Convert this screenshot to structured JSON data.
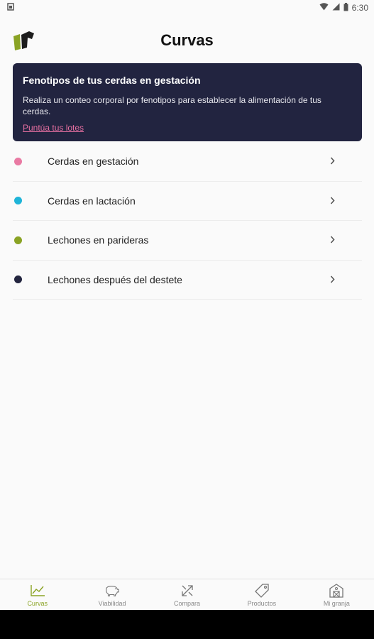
{
  "status_bar": {
    "time": "6:30"
  },
  "header": {
    "title": "Curvas"
  },
  "banner": {
    "title": "Fenotipos de tus cerdas en gestación",
    "text": "Realiza un conteo corporal por fenotipos para establecer la alimentación de tus cerdas.",
    "link": "Puntúa tus lotes"
  },
  "list": {
    "items": [
      {
        "label": "Cerdas en gestación",
        "color": "#e97aa3"
      },
      {
        "label": "Cerdas en lactación",
        "color": "#1fb4d8"
      },
      {
        "label": "Lechones en parideras",
        "color": "#8aa324"
      },
      {
        "label": "Lechones después del destete",
        "color": "#23253f"
      }
    ]
  },
  "bottom_nav": {
    "items": [
      {
        "label": "Curvas",
        "icon": "chart-icon",
        "active": true
      },
      {
        "label": "Viabilidad",
        "icon": "pig-icon",
        "active": false
      },
      {
        "label": "Compara",
        "icon": "compare-arrows-icon",
        "active": false
      },
      {
        "label": "Productos",
        "icon": "tag-icon",
        "active": false
      },
      {
        "label": "Mi granja",
        "icon": "barn-icon",
        "active": false
      }
    ]
  },
  "colors": {
    "accent": "#8aa324",
    "banner_bg": "#222440",
    "link": "#e56fa0"
  }
}
